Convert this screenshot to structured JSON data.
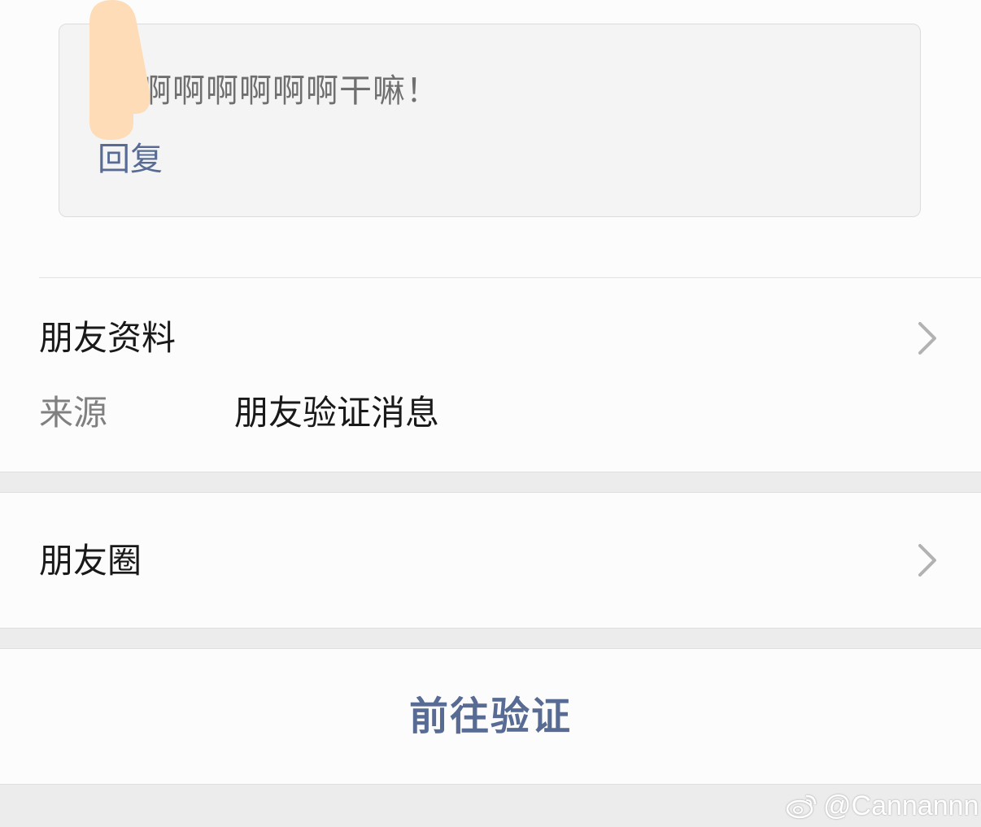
{
  "message": {
    "text": "：啊啊啊啊啊啊干嘛！",
    "reply_label": "回复"
  },
  "friend_info": {
    "title": "朋友资料",
    "source_label": "来源",
    "source_value": "朋友验证消息"
  },
  "moments": {
    "title": "朋友圈"
  },
  "actions": {
    "verify_label": "前往验证"
  },
  "watermark": {
    "handle": "@Cannannn",
    "icon": "weibo-icon"
  },
  "colors": {
    "link": "#576b95",
    "redaction": "#fddcb7",
    "page_background": "#ececec",
    "card_background": "#f4f4f4"
  }
}
